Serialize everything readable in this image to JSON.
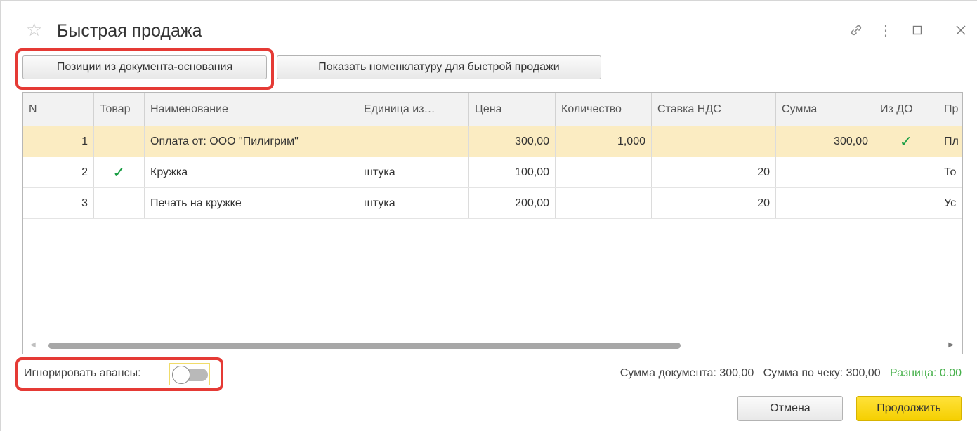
{
  "window": {
    "title": "Быстрая продажа",
    "icons": [
      "star-icon",
      "link-icon",
      "more-icon",
      "maximize-icon",
      "close-icon"
    ]
  },
  "toolbar": {
    "from_base_doc_label": "Позиции из документа-основания",
    "show_nomenclature_label": "Показать номенклатуру для быстрой продажи"
  },
  "table": {
    "columns": [
      "N",
      "Товар",
      "Наименование",
      "Единица из…",
      "Цена",
      "Количество",
      "Ставка НДС",
      "Сумма",
      "Из ДО",
      "Пр"
    ],
    "rows": [
      {
        "n": "1",
        "goods": "",
        "name": "Оплата от: ООО \"Пилигрим\"",
        "unit": "",
        "price": "300,00",
        "qty": "1,000",
        "vat": "",
        "sum": "300,00",
        "from_do": "✓",
        "extra": "Пл"
      },
      {
        "n": "2",
        "goods": "✓",
        "name": "Кружка",
        "unit": "штука",
        "price": "100,00",
        "qty": "",
        "vat": "20",
        "sum": "",
        "from_do": "",
        "extra": "То"
      },
      {
        "n": "3",
        "goods": "",
        "name": "Печать на кружке",
        "unit": "штука",
        "price": "200,00",
        "qty": "",
        "vat": "20",
        "sum": "",
        "from_do": "",
        "extra": "Ус"
      }
    ],
    "selected_row": 0
  },
  "footer": {
    "ignore_advances_label": "Игнорировать авансы:",
    "ignore_advances_on": false,
    "doc_sum_text": "Сумма документа: 300,00",
    "receipt_sum_text": "Сумма по чеку: 300,00",
    "difference_text": "Разница: 0.00",
    "cancel_label": "Отмена",
    "continue_label": "Продолжить"
  },
  "colors": {
    "highlight": "#e53a35",
    "selected_row": "#fbecc2",
    "accent_button": "#f5cf00",
    "check": "#1a9e45",
    "difference": "#46b04a"
  }
}
